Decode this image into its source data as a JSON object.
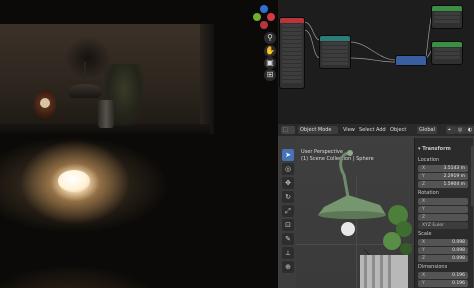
{
  "viewport_3d": {
    "mode_label": "Object Mode",
    "menu": [
      "View",
      "Select",
      "Add",
      "Object"
    ],
    "orientation_label": "Global",
    "overlay_text": [
      "User Perspective",
      "(1) Scene Collection | Sphere"
    ]
  },
  "n_panel": {
    "section_title": "Transform",
    "location_label": "Location",
    "location": [
      {
        "axis": "X",
        "value": "3.5143 m"
      },
      {
        "axis": "Y",
        "value": "2.2919 m"
      },
      {
        "axis": "Z",
        "value": "1.5904 m"
      }
    ],
    "rotation_label": "Rotation",
    "rotation": [
      {
        "axis": "X",
        "value": ""
      },
      {
        "axis": "Y",
        "value": ""
      },
      {
        "axis": "Z",
        "value": ""
      }
    ],
    "rotation_mode": "XYZ Euler",
    "scale_label": "Scale",
    "scale": [
      {
        "axis": "X",
        "value": "0.098"
      },
      {
        "axis": "Y",
        "value": "0.098"
      },
      {
        "axis": "Z",
        "value": "0.098"
      }
    ],
    "dimensions_label": "Dimensions",
    "dimensions": [
      {
        "axis": "X",
        "value": "0.196"
      },
      {
        "axis": "Y",
        "value": "0.196"
      }
    ]
  },
  "gizmo": {
    "axes": [
      {
        "axis": "Z",
        "color": "#2f6fd6"
      },
      {
        "axis": "Y",
        "color": "#6fb12a"
      },
      {
        "axis": "X",
        "color": "#d23a48"
      }
    ]
  },
  "nav_icons": [
    "zoom-icon",
    "hand-icon",
    "camera-icon",
    "grid-icon"
  ],
  "colors": {
    "accent": "#4772b3",
    "node_red": "#b8353d",
    "node_teal": "#2c7d7a",
    "node_green": "#3b8f45",
    "node_blue": "#3a5fa0"
  }
}
